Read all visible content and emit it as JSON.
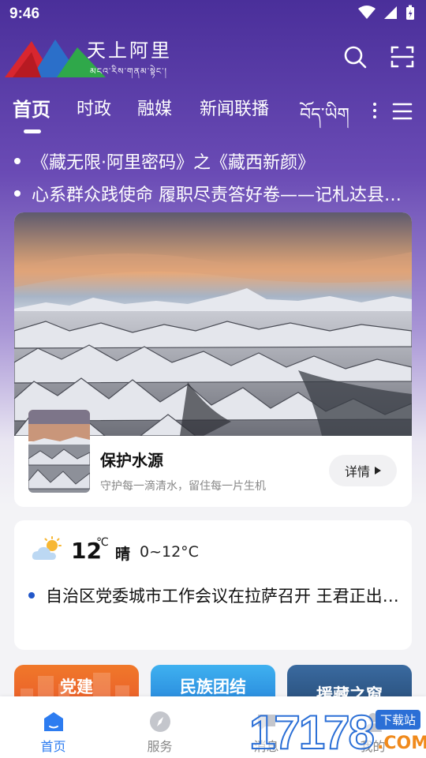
{
  "status_bar": {
    "time": "9:46"
  },
  "header": {
    "logo_title": "天上阿里",
    "logo_subtitle": "མངའ་རིས་གནམ་སྟེང་།",
    "search_icon": "search-icon",
    "scan_icon": "scan-icon"
  },
  "tabs": [
    {
      "label": "首页",
      "active": true
    },
    {
      "label": "时政"
    },
    {
      "label": "融媒"
    },
    {
      "label": "新闻联播"
    },
    {
      "label": "བོད་ཡིག"
    }
  ],
  "headlines": [
    "《藏无限·阿里密码》之《藏西新颜》",
    "心系群众践使命 履职尽责答好卷——记札达县委书记"
  ],
  "hero": {
    "title": "保护水源",
    "subtitle": "守护每一滴清水，留住每一片生机",
    "detail_label": "详情"
  },
  "weather": {
    "temperature": "12",
    "unit": "℃",
    "condition": "晴",
    "range": "0~12°C",
    "news": "自治区党委城市工作会议在拉萨召开 王君正出席并讲话"
  },
  "tiles": [
    {
      "label": "党建",
      "color": "#e8672a"
    },
    {
      "label": "民族团结",
      "color": "#2a8fe0"
    },
    {
      "label": "援藏之窗",
      "color": "#2c5a8a"
    }
  ],
  "bottom_nav": [
    {
      "label": "首页",
      "active": true
    },
    {
      "label": "服务"
    },
    {
      "label": "消息"
    },
    {
      "label": "我的"
    }
  ],
  "watermark": {
    "digits": "17178",
    "badge": "下载站",
    "domain": ".COM"
  },
  "colors": {
    "accent": "#2d7cf0",
    "brand_purple": "#4a2f9a"
  }
}
